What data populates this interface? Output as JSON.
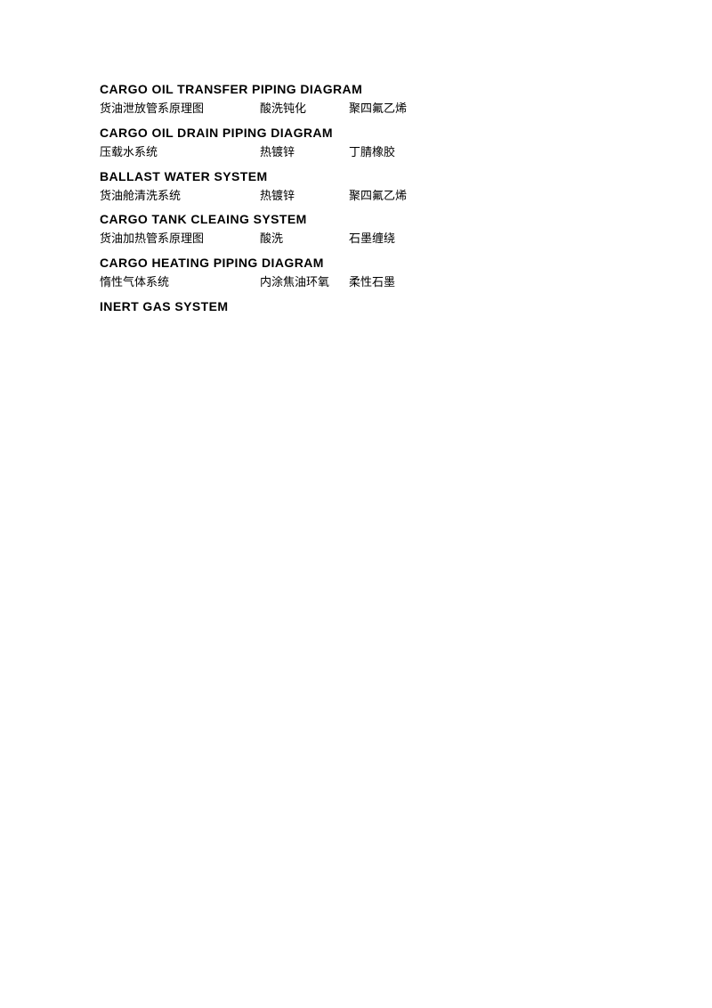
{
  "sections": [
    {
      "id": "cargo-oil-transfer",
      "title": "CARGO OIL TRANSFER PIPING DIAGRAM",
      "subtitle": {
        "col1": "货油泄放管系原理图",
        "col2": "酸洗钝化",
        "col3": "聚四氟乙烯"
      }
    },
    {
      "id": "cargo-oil-drain",
      "title": "CARGO OIL DRAIN PIPING DIAGRAM",
      "subtitle": {
        "col1": "压载水系统",
        "col2": "热镀锌",
        "col3": "丁腈橡胶"
      }
    },
    {
      "id": "ballast-water",
      "title": "BALLAST WATER SYSTEM",
      "subtitle": {
        "col1": "货油舱清洗系统",
        "col2": "热镀锌",
        "col3": "聚四氟乙烯"
      }
    },
    {
      "id": "cargo-tank-cleaning",
      "title": "CARGO TANK CLEAING SYSTEM",
      "subtitle": {
        "col1": "货油加热管系原理图",
        "col2": "酸洗",
        "col3": "石墨缠绕"
      }
    },
    {
      "id": "cargo-heating",
      "title": "CARGO HEATING PIPING DIAGRAM",
      "subtitle": {
        "col1": "惰性气体系统",
        "col2": "内涂焦油环氧",
        "col3": "柔性石墨"
      }
    },
    {
      "id": "inert-gas",
      "title": "INERT GAS SYSTEM",
      "subtitle": null
    }
  ]
}
